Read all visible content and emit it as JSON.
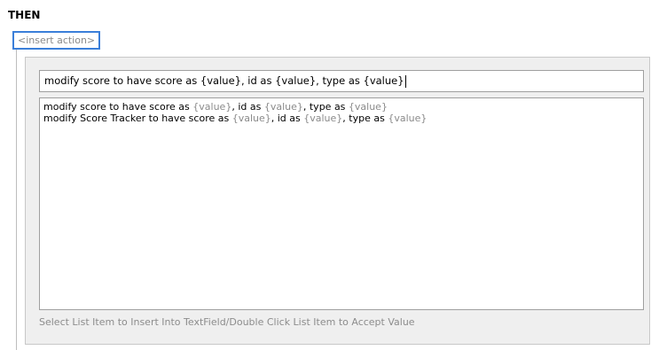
{
  "section": {
    "heading": "THEN",
    "insert_action_label": "<insert action>"
  },
  "editor": {
    "text_field_value": "modify score to have score as {value}, id as {value}, type as {value}",
    "list_items": [
      {
        "segments": [
          {
            "text": "modify score to have score as ",
            "placeholder": false
          },
          {
            "text": "{value}",
            "placeholder": true
          },
          {
            "text": ", id as ",
            "placeholder": false
          },
          {
            "text": "{value}",
            "placeholder": true
          },
          {
            "text": ", type as ",
            "placeholder": false
          },
          {
            "text": "{value}",
            "placeholder": true
          }
        ]
      },
      {
        "segments": [
          {
            "text": "modify Score Tracker to have score as ",
            "placeholder": false
          },
          {
            "text": "{value}",
            "placeholder": true
          },
          {
            "text": ", id as ",
            "placeholder": false
          },
          {
            "text": "{value}",
            "placeholder": true
          },
          {
            "text": ", type as ",
            "placeholder": false
          },
          {
            "text": "{value}",
            "placeholder": true
          }
        ]
      }
    ],
    "hint": "Select List Item to Insert Into TextField/Double Click List Item to Accept Value"
  },
  "colors": {
    "focus_border": "#3b7fd9",
    "placeholder_text": "#8a8a8a",
    "panel_background": "#efefef"
  }
}
